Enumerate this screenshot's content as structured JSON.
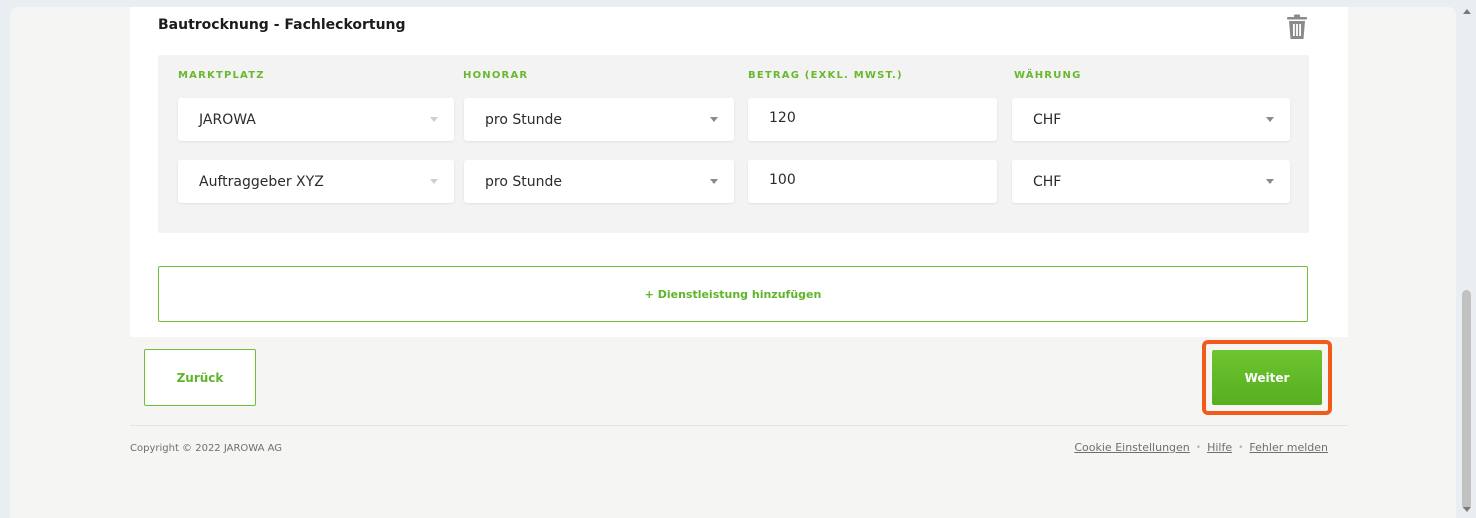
{
  "card": {
    "title": "Bautrocknung - Fachleckortung",
    "delete_icon": "trash-icon"
  },
  "table": {
    "headers": {
      "marketplace": "MARKTPLATZ",
      "fee": "HONORAR",
      "amount": "BETRAG (EXKL. MWST.)",
      "currency": "WÄHRUNG"
    },
    "rows": [
      {
        "marketplace": "JAROWA",
        "fee": "pro Stunde",
        "amount": "120",
        "currency": "CHF"
      },
      {
        "marketplace": "Auftraggeber XYZ",
        "fee": "pro Stunde",
        "amount": "100",
        "currency": "CHF"
      }
    ]
  },
  "actions": {
    "add_service_label": "+ Dienstleistung hinzufügen",
    "back_label": "Zurück",
    "next_label": "Weiter"
  },
  "footer": {
    "copyright": "Copyright © 2022 JAROWA AG",
    "links": [
      "Cookie Einstellungen",
      "Hilfe",
      "Fehler melden"
    ]
  },
  "colors": {
    "accent": "#68b92e",
    "highlight": "#f25a1a",
    "background": "#f5f5f4"
  }
}
